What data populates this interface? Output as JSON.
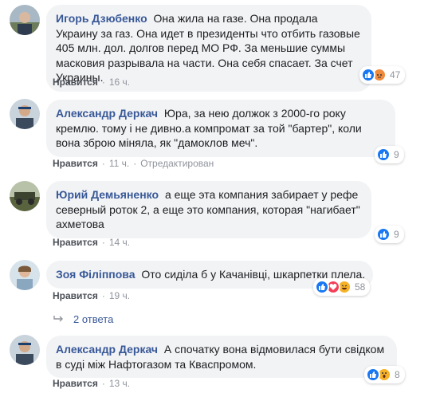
{
  "comments": [
    {
      "author": "Игорь Дзюбенко",
      "text": "Она жила на газе. Она продала Украину за газ. Она идет в президенты что отбить газовые 405 млн. дол. долгов перед МО РФ. За меньшие суммы масковия разрывала на части. Она себя спасает. За счет Украины.",
      "like": "Нравится",
      "time": "16 ч.",
      "edited": "",
      "reaction_count": "47"
    },
    {
      "author": "Александр Деркач",
      "text": "Юра, за нею должок з 2000-го року кремлю. тому і не дивно.а компромат за той \"бартер\", коли вона зброю міняла, як \"дамоклов меч\".",
      "like": "Нравится",
      "time": "11 ч.",
      "edited": "Отредактирован",
      "reaction_count": "9"
    },
    {
      "author": "Юрий Демьяненко",
      "text": "а еще эта компания забирает у рефе северный роток 2, а еще это компания, которая \"нагибает\" ахметова",
      "like": "Нравится",
      "time": "14 ч.",
      "edited": "",
      "reaction_count": "9"
    },
    {
      "author": "Зоя Філіппова",
      "text": "Ото сиділа б у Качанівці, шкарпетки плела.",
      "like": "Нравится",
      "time": "19 ч.",
      "edited": "",
      "reaction_count": "58"
    },
    {
      "author": "Александр Деркач",
      "text": "А спочатку вона відмовилася бути свідком в суді між Нафтогазом та Кваспромом.",
      "like": "Нравится",
      "time": "13 ч.",
      "edited": "",
      "reaction_count": "8"
    }
  ],
  "replies_link": "2 ответа",
  "icons": {
    "like": "thumbs-up-icon",
    "angry": "angry-face-icon",
    "love": "heart-icon",
    "haha": "laughing-face-icon",
    "wow": "surprised-face-icon",
    "reply_arrow": "reply-arrow-icon"
  },
  "colors": {
    "link": "#385898",
    "bubble": "#f2f3f5",
    "like_blue": "#1877f2",
    "love_red": "#f33e58",
    "emoji_yellow": "#f7b125",
    "meta_gray": "#90949c"
  }
}
